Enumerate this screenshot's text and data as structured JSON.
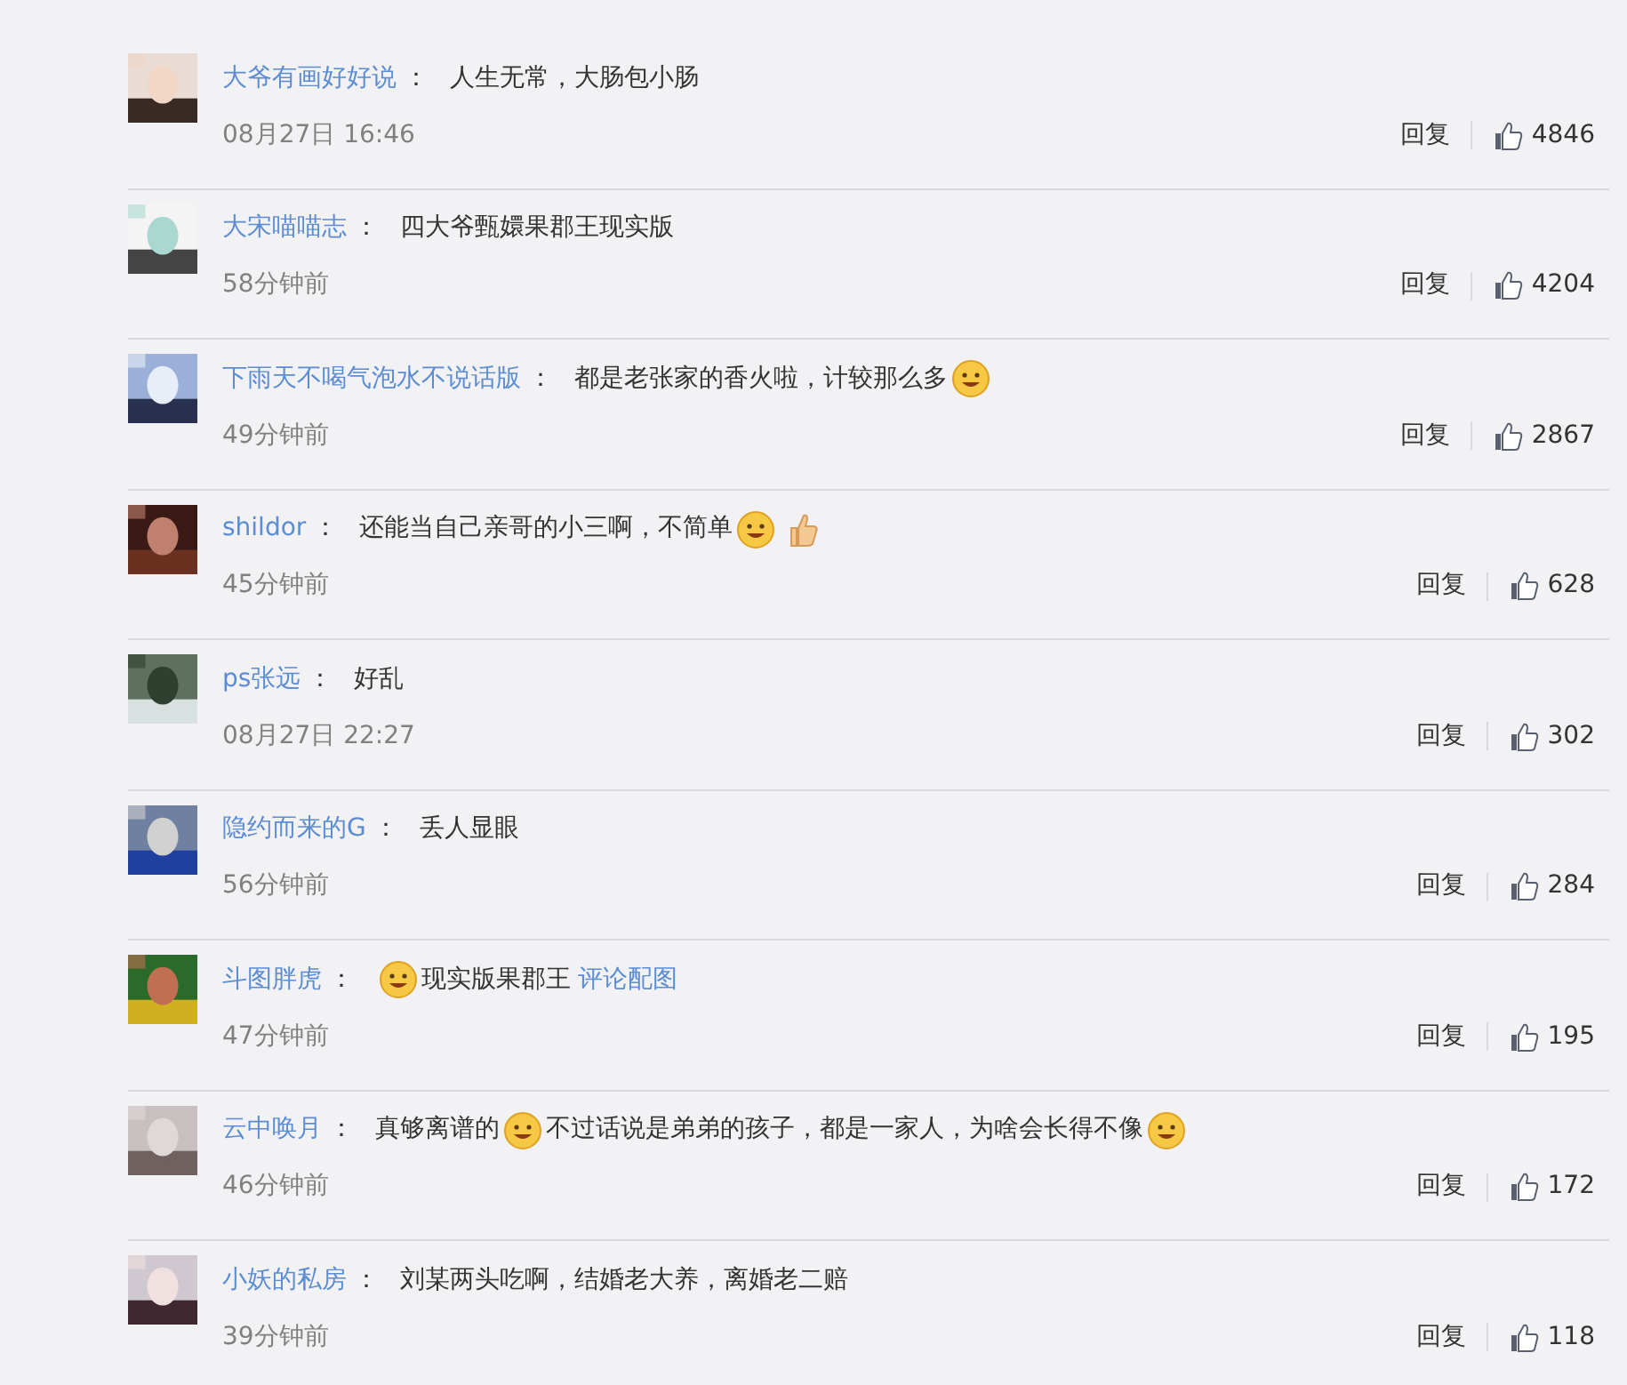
{
  "comments": [
    {
      "user": "大爷有画好好说",
      "colon": "：",
      "content": [
        {
          "kind": "text",
          "text": "人生无常，大肠包小肠"
        }
      ],
      "time": "08月27日 16:46",
      "reply": "回复",
      "likes": "4846"
    },
    {
      "user": "大宋喵喵志",
      "colon": "：",
      "content": [
        {
          "kind": "text",
          "text": "四大爷甄嬛果郡王现实版"
        }
      ],
      "time": "58分钟前",
      "reply": "回复",
      "likes": "4204"
    },
    {
      "user": "下雨天不喝气泡水不说话版",
      "colon": "：",
      "content": [
        {
          "kind": "text",
          "text": "都是老张家的香火啦，计较那么多"
        },
        {
          "kind": "face"
        }
      ],
      "time": "49分钟前",
      "reply": "回复",
      "likes": "2867"
    },
    {
      "user": "shildor",
      "colon": "：",
      "content": [
        {
          "kind": "text",
          "text": "还能当自己亲哥的小三啊，不简单"
        },
        {
          "kind": "face"
        },
        {
          "kind": "thumb"
        }
      ],
      "time": "45分钟前",
      "reply": "回复",
      "likes": "628"
    },
    {
      "user": "ps张远",
      "colon": "：",
      "content": [
        {
          "kind": "text",
          "text": "好乱"
        }
      ],
      "time": "08月27日 22:27",
      "reply": "回复",
      "likes": "302"
    },
    {
      "user": "隐约而来的G",
      "colon": "：",
      "content": [
        {
          "kind": "text",
          "text": "丢人显眼"
        }
      ],
      "time": "56分钟前",
      "reply": "回复",
      "likes": "284"
    },
    {
      "user": "斗图胖虎",
      "colon": "：",
      "content": [
        {
          "kind": "face"
        },
        {
          "kind": "text",
          "text": "现实版果郡王"
        },
        {
          "kind": "link",
          "text": "评论配图"
        }
      ],
      "time": "47分钟前",
      "reply": "回复",
      "likes": "195"
    },
    {
      "user": "云中唤月",
      "colon": "：",
      "content": [
        {
          "kind": "text",
          "text": "真够离谱的"
        },
        {
          "kind": "face"
        },
        {
          "kind": "text",
          "text": "不过话说是弟弟的孩子，都是一家人，为啥会长得不像"
        },
        {
          "kind": "face"
        }
      ],
      "time": "46分钟前",
      "reply": "回复",
      "likes": "172"
    },
    {
      "user": "小妖的私房",
      "colon": "：",
      "content": [
        {
          "kind": "text",
          "text": "刘某两头吃啊，结婚老大养，离婚老二赔"
        }
      ],
      "time": "39分钟前",
      "reply": "回复",
      "likes": "118"
    }
  ]
}
